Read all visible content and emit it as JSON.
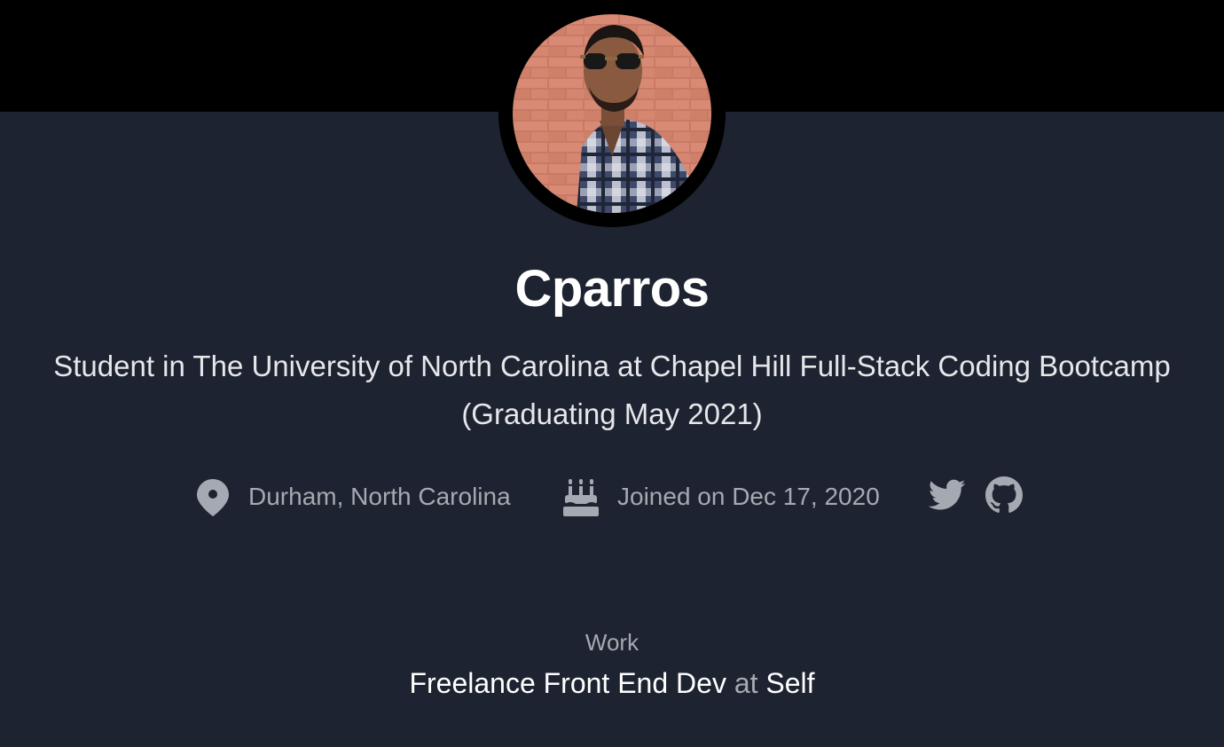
{
  "profile": {
    "name": "Cparros",
    "bio_line1": "Student in The University of North Carolina at Chapel Hill Full-Stack Coding Bootcamp",
    "bio_line2": "(Graduating May 2021)",
    "location": "Durham, North Carolina",
    "joined": "Joined on Dec 17, 2020",
    "icons": {
      "location": "map-pin-icon",
      "joined": "cake-icon",
      "twitter": "twitter-icon",
      "github": "github-icon"
    }
  },
  "work": {
    "label": "Work",
    "title": "Freelance Front End Dev",
    "at": "at",
    "employer": "Self"
  },
  "colors": {
    "background": "#1d2330",
    "header_band": "#000000",
    "text_primary": "#ffffff",
    "text_muted": "#a5a9b1"
  }
}
